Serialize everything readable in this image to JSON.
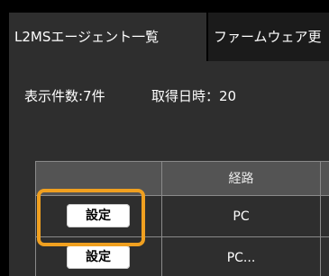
{
  "tabs": [
    {
      "label": "L2MSエージェント一覧"
    },
    {
      "label": "ファームウェア更"
    }
  ],
  "info": {
    "count_text": "表示件数:7件",
    "date_text": "取得日時：20"
  },
  "table": {
    "headers": [
      "",
      "経路",
      ""
    ],
    "rows": [
      {
        "button_label": "設定",
        "route": "PC"
      },
      {
        "button_label": "設定",
        "route": "PC..."
      }
    ]
  },
  "colors": {
    "highlight": "#f0a020",
    "header_bg": "#545454",
    "panel_bg": "#2e2e2e"
  }
}
